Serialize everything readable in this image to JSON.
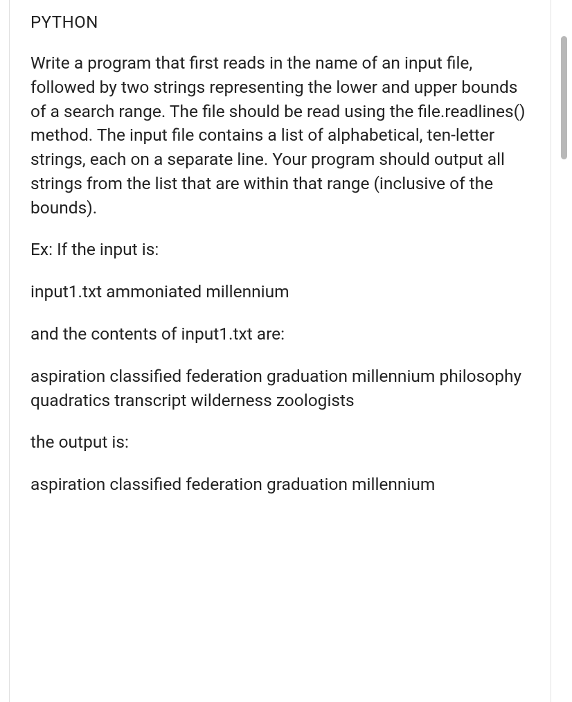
{
  "heading": "PYTHON",
  "paragraphs": {
    "p1": "Write a program that first reads in the name of an input file, followed by two strings representing the lower and upper bounds of a search range. The file should be read using the file.readlines() method. The input file contains a list of alphabetical, ten-letter strings, each on a separate line. Your program should output all strings from the list that are within that range (inclusive of the bounds).",
    "p2": "Ex: If the input is:",
    "p3": "input1.txt ammoniated millennium",
    "p4": "and the contents of input1.txt are:",
    "p5": "aspiration classified federation graduation millennium philosophy quadratics transcript wilderness zoologists",
    "p6": "the output is:",
    "p7": "aspiration classified federation graduation millennium"
  }
}
